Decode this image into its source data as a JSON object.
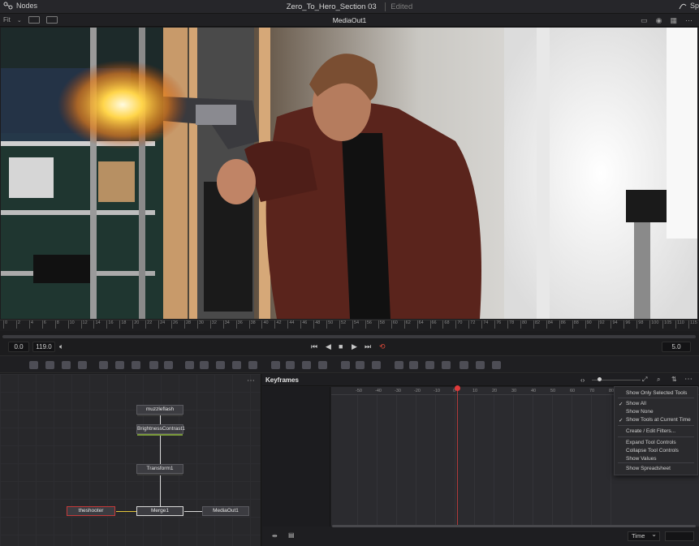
{
  "topbar": {
    "nodes_label": "Nodes",
    "project_title": "Zero_To_Hero_Section 03",
    "edited_label": "Edited",
    "right_label": "Sp"
  },
  "viewer": {
    "fit_label": "Fit",
    "node_name": "MediaOut1"
  },
  "ruler": {
    "ticks": [
      "0",
      "2",
      "4",
      "6",
      "8",
      "10",
      "12",
      "14",
      "16",
      "18",
      "20",
      "22",
      "24",
      "26",
      "28",
      "30",
      "32",
      "34",
      "36",
      "38",
      "40",
      "42",
      "44",
      "46",
      "48",
      "50",
      "52",
      "54",
      "56",
      "58",
      "60",
      "62",
      "64",
      "66",
      "68",
      "70",
      "72",
      "74",
      "76",
      "78",
      "80",
      "82",
      "84",
      "86",
      "88",
      "90",
      "92",
      "94",
      "96",
      "98",
      "100",
      "105",
      "110",
      "115"
    ]
  },
  "transport": {
    "start_value": "0.0",
    "end_value": "119.0",
    "current_frame": "5.0"
  },
  "nodes": {
    "items": [
      {
        "id": "muzzleflash",
        "label": "muzzleflash"
      },
      {
        "id": "brightness",
        "label": "BrightnessContrast1"
      },
      {
        "id": "transform",
        "label": "Transform1"
      },
      {
        "id": "theshooter",
        "label": "theshooter"
      },
      {
        "id": "merge",
        "label": "Merge1"
      },
      {
        "id": "mediaout",
        "label": "MediaOut1"
      }
    ]
  },
  "keyframes": {
    "title": "Keyframes",
    "ruler": [
      "-50",
      "-40",
      "-30",
      "-20",
      "-10",
      "0",
      "10",
      "20",
      "30",
      "40",
      "50",
      "60",
      "70",
      "80"
    ],
    "time_mode": "Time"
  },
  "menu": {
    "items": [
      {
        "label": "Show Only Selected Tools",
        "checked": false
      },
      {
        "label": "Show All",
        "checked": true
      },
      {
        "label": "Show None",
        "checked": false
      },
      {
        "label": "Show Tools at Current Time",
        "checked": true
      },
      {
        "label": "Create / Edit Filters...",
        "checked": false
      },
      {
        "label": "Expand Tool Controls",
        "checked": false
      },
      {
        "label": "Collapse Tool Controls",
        "checked": false
      },
      {
        "label": "Show Values",
        "checked": false
      },
      {
        "label": "Show Spreadsheet",
        "checked": false
      }
    ]
  },
  "colors": {
    "accent": "#e2c33a",
    "playhead": "#e03a3a"
  }
}
